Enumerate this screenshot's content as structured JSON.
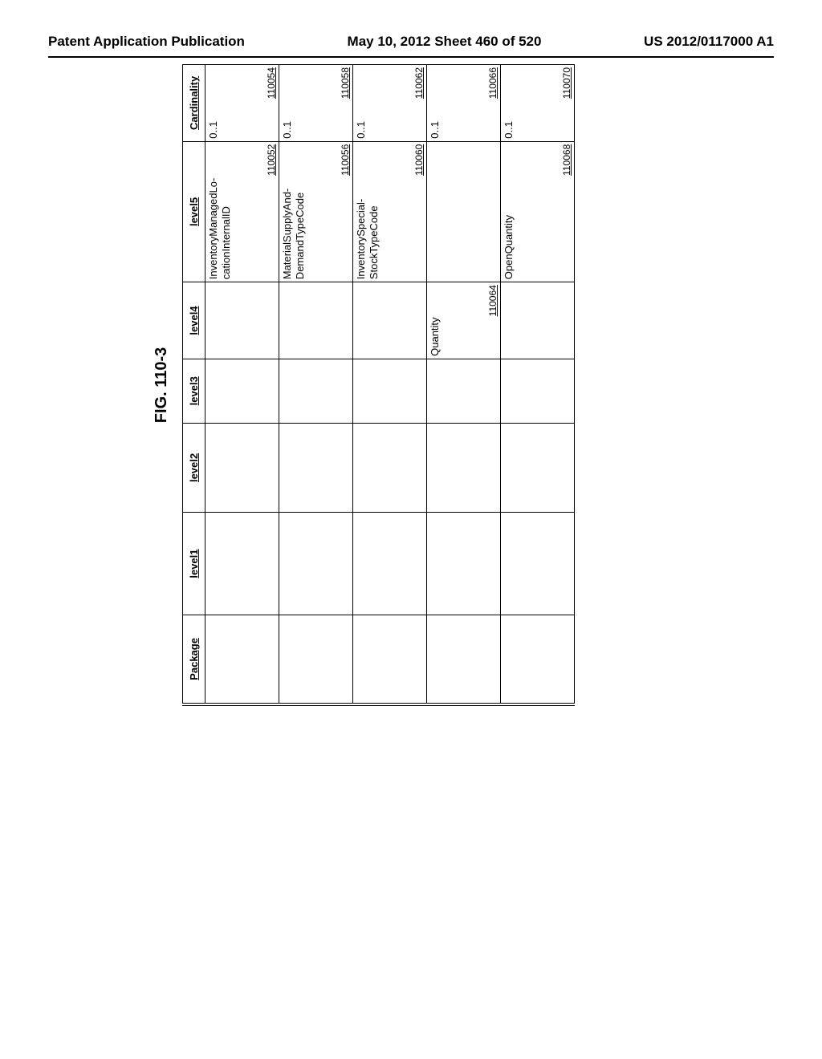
{
  "header": {
    "left": "Patent Application Publication",
    "center": "May 10, 2012  Sheet 460 of 520",
    "right": "US 2012/0117000 A1"
  },
  "figure_label": "FIG. 110-3",
  "columns": {
    "package": "Package",
    "level1": "level1",
    "level2": "level2",
    "level3": "level3",
    "level4": "level4",
    "level5": "level5",
    "cardinality": "Cardinality"
  },
  "rows": [
    {
      "package": "",
      "l1": "",
      "l2": "",
      "l3": "",
      "l4": "",
      "l5": "InventoryManagedLo-cationInternalID",
      "ref5": "110052",
      "card": "0..1",
      "refc": "110054"
    },
    {
      "package": "",
      "l1": "",
      "l2": "",
      "l3": "",
      "l4": "",
      "l5": "MaterialSupplyAnd-DemandTypeCode",
      "ref5": "110056",
      "card": "0..1",
      "refc": "110058"
    },
    {
      "package": "",
      "l1": "",
      "l2": "",
      "l3": "",
      "l4": "",
      "l5": "InventorySpecial-StockTypeCode",
      "ref5": "110060",
      "card": "0..1",
      "refc": "110062"
    },
    {
      "package": "",
      "l1": "",
      "l2": "",
      "l3": "",
      "l4": "Quantity",
      "ref4": "110064",
      "l5": "",
      "ref5": "",
      "card": "0..1",
      "refc": "110066"
    },
    {
      "package": "",
      "l1": "",
      "l2": "",
      "l3": "",
      "l4": "",
      "l5": "OpenQuantity",
      "ref5": "110068",
      "card": "0..1",
      "refc": "110070"
    }
  ]
}
